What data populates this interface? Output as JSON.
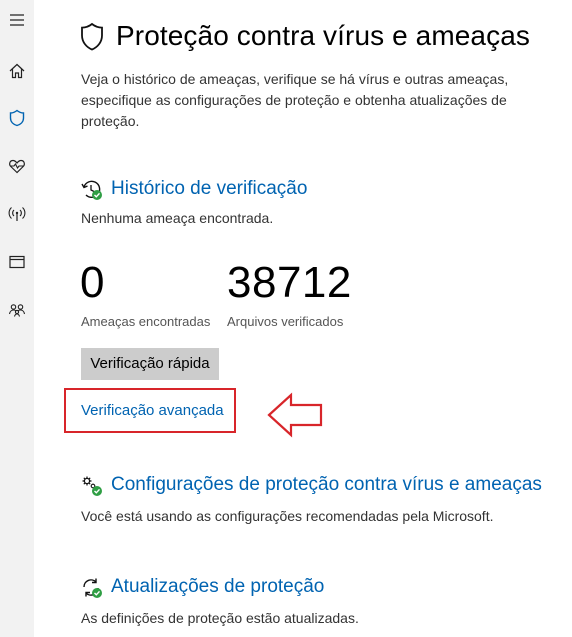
{
  "page": {
    "title": "Proteção contra vírus e ameaças",
    "description": "Veja o histórico de ameaças, verifique se há vírus e outras ameaças, especifique as configurações de proteção e obtenha atualizações de proteção."
  },
  "sidebar": {
    "items": [
      {
        "icon": "hamburger-menu-icon"
      },
      {
        "icon": "home-icon"
      },
      {
        "icon": "shield-icon",
        "active": true
      },
      {
        "icon": "heart-health-icon"
      },
      {
        "icon": "wireless-network-icon"
      },
      {
        "icon": "app-browser-icon"
      },
      {
        "icon": "family-icon"
      }
    ]
  },
  "scan_history": {
    "title": "Histórico de verificação",
    "status": "Nenhuma ameaça encontrada.",
    "threats_count": "0",
    "threats_label": "Ameaças encontradas",
    "files_count": "38712",
    "files_label": "Arquivos verificados",
    "quick_scan_label": "Verificação rápida",
    "advanced_scan_label": "Verificação avançada"
  },
  "settings": {
    "title": "Configurações de proteção contra vírus e ameaças",
    "status": "Você está usando as configurações recomendadas pela Microsoft."
  },
  "updates": {
    "title": "Atualizações de proteção",
    "status": "As definições de proteção estão atualizadas."
  },
  "colors": {
    "accent": "#0063b1",
    "highlight": "#d8252a",
    "ok_green": "#2f9e44",
    "sidebar_bg": "#f2f2f2",
    "button_bg": "#cccccc"
  }
}
